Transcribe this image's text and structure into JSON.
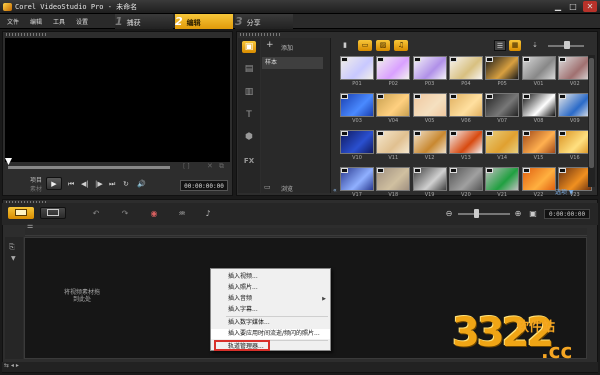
{
  "window": {
    "title": "Corel VideoStudio Pro - 未命名",
    "min": "▁",
    "max": "□",
    "close": "✕"
  },
  "menu": [
    "文件",
    "编辑",
    "工具",
    "设置"
  ],
  "steps": [
    {
      "num": "1",
      "label": "捕获"
    },
    {
      "num": "2",
      "label": "编辑"
    },
    {
      "num": "3",
      "label": "分享"
    }
  ],
  "preview": {
    "project_label": "项目",
    "clip_label": "素材",
    "timecode": "00:00:00:00",
    "brackets": "[ ]",
    "transport": [
      "⏮",
      "◀|",
      "|▶",
      "⏭",
      "↻",
      "🔊"
    ]
  },
  "library": {
    "add_label": "添加",
    "folder_sample": "样本",
    "browse_label": "浏览",
    "collapse": "«",
    "bottom_text": "选项 ▼",
    "side_icons": [
      "media-icon",
      "instant-project-icon",
      "transition-icon",
      "title-icon",
      "graphic-icon",
      "filter-icon"
    ],
    "side_glyphs": [
      "▣",
      "▤",
      "▥",
      "T",
      "⬢",
      "FX"
    ],
    "thumbs": [
      {
        "label": "P01",
        "color": "#f2efe8",
        "accent": "#c8c8ff"
      },
      {
        "label": "P02",
        "color": "#f3f1ee",
        "accent": "#d9a0ff"
      },
      {
        "label": "P03",
        "color": "#f5f3f8",
        "accent": "#b090e8"
      },
      {
        "label": "P04",
        "color": "#f7f4f0",
        "accent": "#d8c080"
      },
      {
        "label": "P05",
        "color": "#1a1a1a",
        "accent": "#d8a040"
      },
      {
        "label": "V01",
        "color": "#d8d8d8",
        "accent": "#888888"
      },
      {
        "label": "V02",
        "color": "#dcdcdc",
        "accent": "#a07070"
      },
      {
        "label": "V03",
        "color": "#1a3fb0",
        "accent": "#4a8aff"
      },
      {
        "label": "V04",
        "color": "#c8a050",
        "accent": "#ffd080"
      },
      {
        "label": "V05",
        "color": "#f0c8a0",
        "accent": "#f5e0c0"
      },
      {
        "label": "V06",
        "color": "#e0b060",
        "accent": "#ffe0a0"
      },
      {
        "label": "V07",
        "color": "#222222",
        "accent": "#777777"
      },
      {
        "label": "V08",
        "color": "#111111",
        "accent": "#ffffff"
      },
      {
        "label": "V09",
        "color": "#e8e8e8",
        "accent": "#2a6ac8"
      },
      {
        "label": "V10",
        "color": "#101a60",
        "accent": "#2a50d0"
      },
      {
        "label": "V11",
        "color": "#f5e8d0",
        "accent": "#e0c090"
      },
      {
        "label": "V12",
        "color": "#f0e0c8",
        "accent": "#c88830"
      },
      {
        "label": "V13",
        "color": "#f2f2f2",
        "accent": "#d84a10"
      },
      {
        "label": "V14",
        "color": "#e8d080",
        "accent": "#e0a030"
      },
      {
        "label": "V15",
        "color": "#a04818",
        "accent": "#ffb050"
      },
      {
        "label": "V16",
        "color": "#d89020",
        "accent": "#ffe080"
      },
      {
        "label": "V17",
        "color": "#2a3a90",
        "accent": "#90b0ff"
      },
      {
        "label": "V18",
        "color": "#a09080",
        "accent": "#d0c0a0"
      },
      {
        "label": "V19",
        "color": "#404040",
        "accent": "#d0d0d0"
      },
      {
        "label": "V20",
        "color": "#555555",
        "accent": "#a0a0a0"
      },
      {
        "label": "V21",
        "color": "#c0c0c0",
        "accent": "#20a040"
      },
      {
        "label": "V22",
        "color": "#e06010",
        "accent": "#ffb040"
      },
      {
        "label": "V23",
        "color": "#6a3010",
        "accent": "#f09020"
      }
    ]
  },
  "timeline": {
    "timecode": "0:00:00:00",
    "drop_hint": "将视频素材拖到此处"
  },
  "context_menu": [
    "插入视频...",
    "插入照片...",
    "插入音频",
    "插入字幕...",
    "插入数字媒体...",
    "插入要应用时间流逝/频闪的照片...",
    "轨道管理器..."
  ],
  "watermark": {
    "logo": "3322",
    "site": "软件站",
    "cc": ".cc"
  },
  "colors": {
    "accent": "#f2b21c",
    "panel": "#2d2d2d",
    "highlight": "#d8302a"
  }
}
